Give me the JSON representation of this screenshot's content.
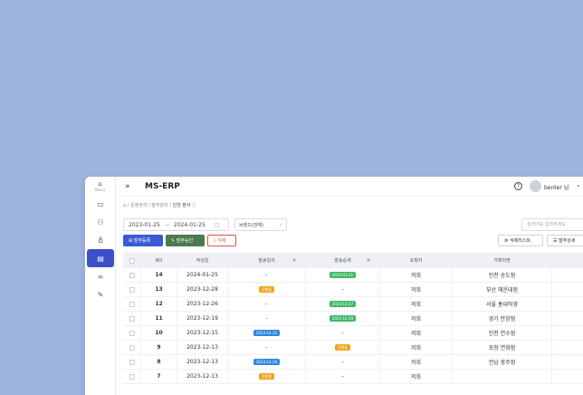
{
  "sidebar": {
    "menu_label": "Menu",
    "items": [
      {
        "icon": "monitor-icon"
      },
      {
        "icon": "users-icon"
      },
      {
        "icon": "bulb-icon"
      },
      {
        "icon": "card-icon"
      },
      {
        "icon": "link-icon"
      },
      {
        "icon": "pen-icon"
      }
    ]
  },
  "header": {
    "app_title": "MS-ERP",
    "user_name": "benter 님",
    "help": "?"
  },
  "breadcrumb": {
    "home_icon": "home-icon",
    "items": [
      "운영관리",
      "발주관리"
    ],
    "current": "인천 본사"
  },
  "filters": {
    "date_from": "2023-01-25",
    "date_to": "2024-01-25",
    "select_value": "브랜드(전체)",
    "search_placeholder": "검색어를 입력하세요"
  },
  "actions": {
    "add_label": "발주등록",
    "approve_label": "발주승인",
    "delete_label": "삭제",
    "list_label": "삭제리스트",
    "detail_label": "발주상세"
  },
  "table": {
    "headers": [
      "NO",
      "작성일",
      "발송일자",
      "발송승계",
      "요청자",
      "거래처명",
      ""
    ],
    "rows": [
      {
        "no": "14",
        "date": "2024-01-25",
        "send": "-",
        "confirm": "2024-01-31",
        "confirm_color": "green",
        "req": "저희",
        "client": "인천 송도점"
      },
      {
        "no": "13",
        "date": "2023-12-28",
        "send": "진행중",
        "send_color": "orange",
        "confirm": "-",
        "req": "저희",
        "client": "부산 해운대점"
      },
      {
        "no": "12",
        "date": "2023-12-26",
        "send": "-",
        "confirm": "2023-12-27",
        "confirm_color": "green",
        "req": "저희",
        "client": "서울 홍대직영"
      },
      {
        "no": "11",
        "date": "2023-12-19",
        "send": "-",
        "confirm": "2023-12-19",
        "confirm_color": "green",
        "req": "저희",
        "client": "경기 안양점"
      },
      {
        "no": "10",
        "date": "2023-12-15",
        "send": "2023-12-15",
        "send_color": "blue",
        "confirm": "-",
        "req": "저희",
        "client": "인천 연수점"
      },
      {
        "no": "9",
        "date": "2023-12-13",
        "send": "-",
        "confirm": "진행중",
        "confirm_color": "orange",
        "req": "저희",
        "client": "포항 연화점"
      },
      {
        "no": "8",
        "date": "2023-12-13",
        "send": "2023-12-20",
        "send_color": "blue",
        "confirm": "-",
        "req": "저희",
        "client": "전남 광주점"
      },
      {
        "no": "7",
        "date": "2023-12-13",
        "send": "진행중",
        "send_color": "orange",
        "confirm": "-",
        "req": "저희",
        "client": ""
      }
    ]
  }
}
